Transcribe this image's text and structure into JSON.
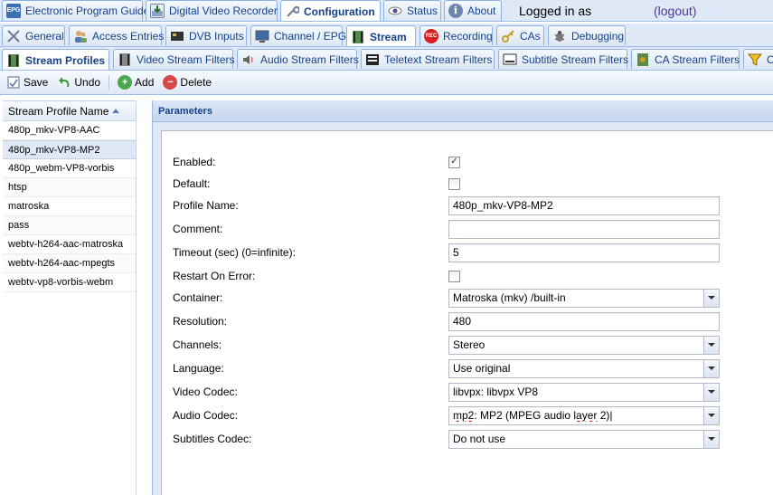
{
  "main_tabs": [
    {
      "label": "Electronic Program Guide",
      "icon": "epg-icon"
    },
    {
      "label": "Digital Video Recorder",
      "icon": "dvr-icon"
    },
    {
      "label": "Configuration",
      "icon": "wrench-icon",
      "active": true
    },
    {
      "label": "Status",
      "icon": "eye-icon"
    },
    {
      "label": "About",
      "icon": "info-icon"
    }
  ],
  "session": {
    "logged_in": "Logged in as",
    "logout": "(logout)"
  },
  "config_tabs": [
    {
      "label": "General",
      "icon": "tools-icon"
    },
    {
      "label": "Access Entries",
      "icon": "users-icon"
    },
    {
      "label": "DVB Inputs",
      "icon": "card-icon"
    },
    {
      "label": "Channel / EPG",
      "icon": "tv-icon"
    },
    {
      "label": "Stream",
      "icon": "stream-icon",
      "active": true
    },
    {
      "label": "Recording",
      "icon": "rec-icon"
    },
    {
      "label": "CAs",
      "icon": "key-icon"
    },
    {
      "label": "Debugging",
      "icon": "bug-icon"
    }
  ],
  "stream_tabs": [
    {
      "label": "Stream Profiles",
      "icon": "film-icon",
      "active": true
    },
    {
      "label": "Video Stream Filters",
      "icon": "video-icon"
    },
    {
      "label": "Audio Stream Filters",
      "icon": "speaker-icon"
    },
    {
      "label": "Teletext Stream Filters",
      "icon": "teletext-icon"
    },
    {
      "label": "Subtitle Stream Filters",
      "icon": "subtitle-icon"
    },
    {
      "label": "CA Stream Filters",
      "icon": "ca-icon"
    },
    {
      "label": "O",
      "icon": "funnel-icon"
    }
  ],
  "toolbar": {
    "save": "Save",
    "undo": "Undo",
    "add": "Add",
    "delete": "Delete"
  },
  "grid": {
    "header": "Stream Profile Name",
    "rows": [
      "480p_mkv-VP8-AAC",
      "480p_mkv-VP8-MP2",
      "480p_webm-VP8-vorbis",
      "htsp",
      "matroska",
      "pass",
      "webtv-h264-aac-matroska",
      "webtv-h264-aac-mpegts",
      "webtv-vp8-vorbis-webm"
    ],
    "selected_index": 1
  },
  "panel": {
    "title": "Parameters",
    "fields": {
      "enabled": {
        "label": "Enabled:",
        "checked": true
      },
      "default": {
        "label": "Default:",
        "checked": false
      },
      "profile_name": {
        "label": "Profile Name:",
        "value": "480p_mkv-VP8-MP2"
      },
      "comment": {
        "label": "Comment:",
        "value": ""
      },
      "timeout": {
        "label": "Timeout (sec) (0=infinite):",
        "value": "5"
      },
      "restart": {
        "label": "Restart On Error:",
        "checked": false
      },
      "container": {
        "label": "Container:",
        "value": "Matroska (mkv) /built-in"
      },
      "resolution": {
        "label": "Resolution:",
        "value": "480"
      },
      "channels": {
        "label": "Channels:",
        "value": "Stereo"
      },
      "language": {
        "label": "Language:",
        "value": "Use original"
      },
      "video_codec": {
        "label": "Video Codec:",
        "value": "libvpx: libvpx VP8"
      },
      "audio_codec": {
        "label": "Audio Codec:",
        "value_a": "mp2",
        "value_b": ": MP2 (MPEG audio ",
        "value_c": "layer",
        "value_d": " 2)"
      },
      "subtitles_codec": {
        "label": "Subtitles Codec:",
        "value": "Do not use"
      }
    }
  },
  "colors": {
    "accent": "#15428b",
    "bar_bg": "#dfe8f6",
    "border": "#99bbe8"
  }
}
